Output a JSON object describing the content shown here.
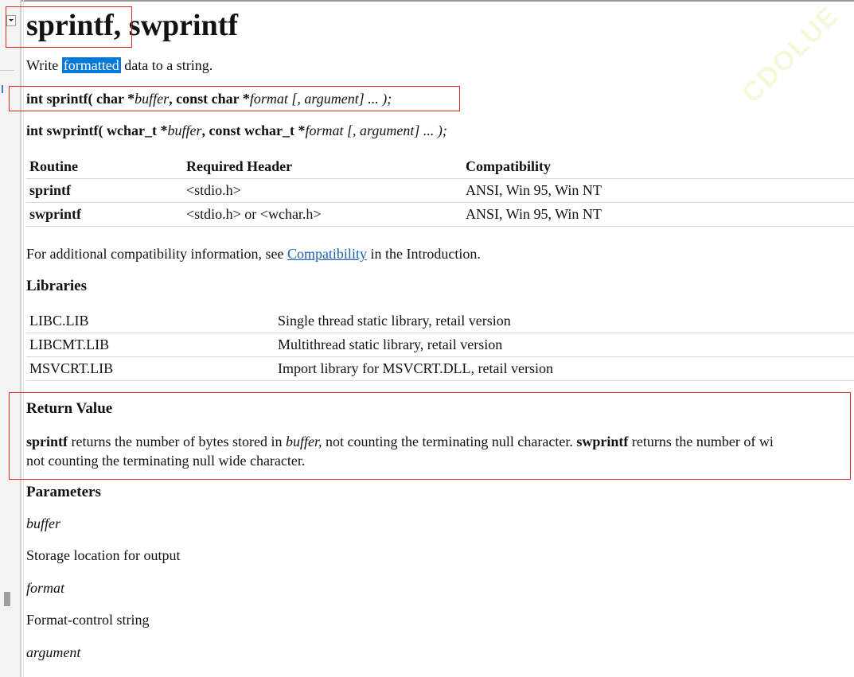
{
  "page": {
    "title_part1": "sprintf,",
    "title_part2": "swprintf",
    "summary_before": "Write ",
    "summary_highlight": "formatted",
    "summary_after": " data to a string."
  },
  "syntax": [
    {
      "ret": "int sprintf( char *",
      "p1": "buffer",
      "mid": ", const char *",
      "p2": "format",
      "open": " [, ",
      "p3": "argument",
      "close": "] ... );"
    },
    {
      "ret": "int swprintf( wchar_t *",
      "p1": "buffer",
      "mid": ", const wchar_t *",
      "p2": "format",
      "open": " [, ",
      "p3": "argument",
      "close": "] ... );"
    }
  ],
  "routines": {
    "headers": [
      "Routine",
      "Required Header",
      "Compatibility"
    ],
    "rows": [
      [
        "sprintf",
        "<stdio.h>",
        "ANSI, Win 95, Win NT"
      ],
      [
        "swprintf",
        "<stdio.h> or <wchar.h>",
        "ANSI, Win 95, Win NT"
      ]
    ]
  },
  "compat_note": {
    "before": "For additional compatibility information, see ",
    "link": "Compatibility",
    "after": " in the Introduction."
  },
  "libraries": {
    "heading": "Libraries",
    "rows": [
      [
        "LIBC.LIB",
        "Single thread static library, retail version"
      ],
      [
        "LIBCMT.LIB",
        "Multithread static library, retail version"
      ],
      [
        "MSVCRT.LIB",
        "Import library for MSVCRT.DLL, retail version"
      ]
    ]
  },
  "return_value": {
    "heading": "Return Value",
    "fn1": "sprintf",
    "text1": " returns the number of bytes stored in ",
    "var1": "buffer,",
    "text2": " not counting the terminating null character. ",
    "fn2": "swprintf",
    "text3": " returns the number of wi",
    "line2": "not counting the terminating null wide character."
  },
  "parameters": {
    "heading": "Parameters",
    "items": [
      {
        "name": "buffer",
        "desc": "Storage location for output"
      },
      {
        "name": "format",
        "desc": "Format-control string"
      },
      {
        "name": "argument",
        "desc": ""
      }
    ]
  },
  "watermark": "CDOLUE",
  "colors": {
    "highlight": "#0a78d7",
    "link": "#1a5fb4",
    "annotation_box": "#e0252a"
  }
}
